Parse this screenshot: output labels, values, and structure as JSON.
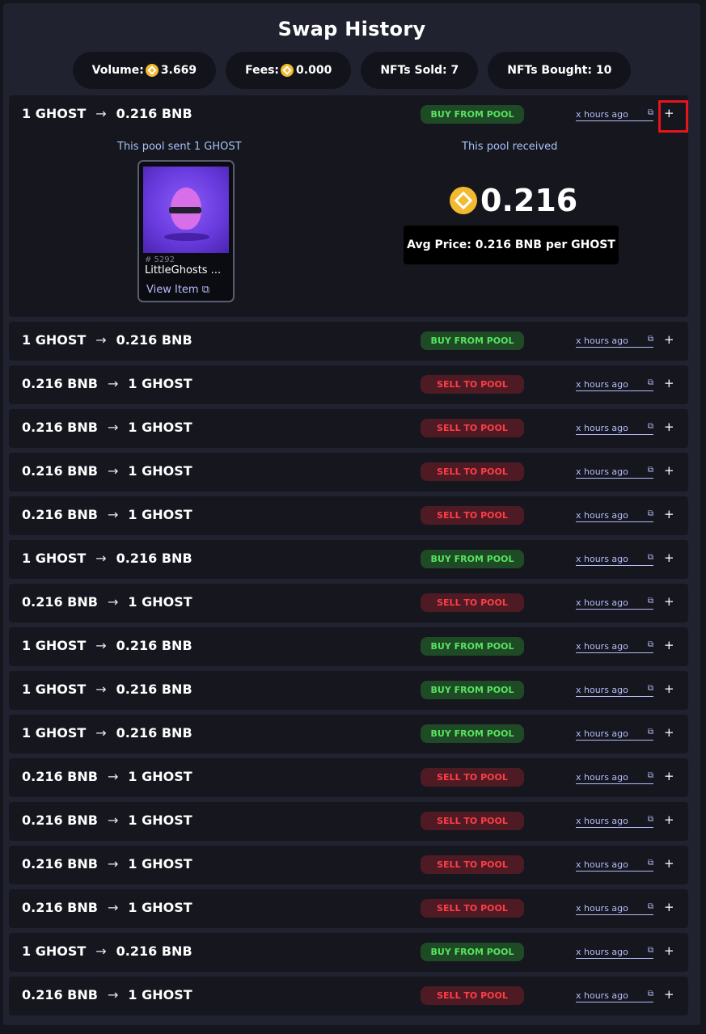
{
  "title": "Swap History",
  "stats": [
    {
      "label": "Volume:",
      "coin": true,
      "value": "3.669"
    },
    {
      "label": "Fees:",
      "coin": true,
      "value": "0.000"
    },
    {
      "label": "NFTs Sold: 7",
      "coin": false,
      "value": ""
    },
    {
      "label": "NFTs Bought: 10",
      "coin": false,
      "value": ""
    }
  ],
  "expanded": {
    "sent_label": "This pool sent 1 GHOST",
    "received_label": "This pool received",
    "nft_id": "# 5292",
    "nft_name": "LittleGhosts ...",
    "view_item": "View Item",
    "received_amount": "0.216",
    "avg_price": "Avg Price: 0.216 BNB per GHOST"
  },
  "rows": [
    {
      "from": "1 GHOST",
      "to": "0.216 BNB",
      "badge": "BUY FROM POOL",
      "type": "buy",
      "time": "x hours ago",
      "expanded": true
    },
    {
      "from": "1 GHOST",
      "to": "0.216 BNB",
      "badge": "BUY FROM POOL",
      "type": "buy",
      "time": "x hours ago"
    },
    {
      "from": "0.216 BNB",
      "to": "1 GHOST",
      "badge": "SELL TO POOL",
      "type": "sell",
      "time": "x hours ago"
    },
    {
      "from": "0.216 BNB",
      "to": "1 GHOST",
      "badge": "SELL TO POOL",
      "type": "sell",
      "time": "x hours ago"
    },
    {
      "from": "0.216 BNB",
      "to": "1 GHOST",
      "badge": "SELL TO POOL",
      "type": "sell",
      "time": "x hours ago"
    },
    {
      "from": "0.216 BNB",
      "to": "1 GHOST",
      "badge": "SELL TO POOL",
      "type": "sell",
      "time": "x hours ago"
    },
    {
      "from": "1 GHOST",
      "to": "0.216 BNB",
      "badge": "BUY FROM POOL",
      "type": "buy",
      "time": "x hours ago"
    },
    {
      "from": "0.216 BNB",
      "to": "1 GHOST",
      "badge": "SELL TO POOL",
      "type": "sell",
      "time": "x hours ago"
    },
    {
      "from": "1 GHOST",
      "to": "0.216 BNB",
      "badge": "BUY FROM POOL",
      "type": "buy",
      "time": "x hours ago"
    },
    {
      "from": "1 GHOST",
      "to": "0.216 BNB",
      "badge": "BUY FROM POOL",
      "type": "buy",
      "time": "x hours ago"
    },
    {
      "from": "1 GHOST",
      "to": "0.216 BNB",
      "badge": "BUY FROM POOL",
      "type": "buy",
      "time": "x hours ago"
    },
    {
      "from": "0.216 BNB",
      "to": "1 GHOST",
      "badge": "SELL TO POOL",
      "type": "sell",
      "time": "x hours ago"
    },
    {
      "from": "0.216 BNB",
      "to": "1 GHOST",
      "badge": "SELL TO POOL",
      "type": "sell",
      "time": "x hours ago"
    },
    {
      "from": "0.216 BNB",
      "to": "1 GHOST",
      "badge": "SELL TO POOL",
      "type": "sell",
      "time": "x hours ago"
    },
    {
      "from": "0.216 BNB",
      "to": "1 GHOST",
      "badge": "SELL TO POOL",
      "type": "sell",
      "time": "x hours ago"
    },
    {
      "from": "1 GHOST",
      "to": "0.216 BNB",
      "badge": "BUY FROM POOL",
      "type": "buy",
      "time": "x hours ago"
    },
    {
      "from": "0.216 BNB",
      "to": "1 GHOST",
      "badge": "SELL TO POOL",
      "type": "sell",
      "time": "x hours ago"
    }
  ],
  "colors": {
    "buy_text": "#57e35f",
    "sell_text": "#ff3d46",
    "link": "#b6bdf8",
    "coin": "#f3ba2f",
    "highlight": "#e8141c"
  },
  "icons": {
    "arrow": "arrow-right-icon",
    "external": "external-link-icon",
    "expand": "plus-icon",
    "coin": "bnb-coin-icon"
  },
  "glyphs": {
    "arrow": "→",
    "external": "⧉",
    "plus": "+"
  }
}
